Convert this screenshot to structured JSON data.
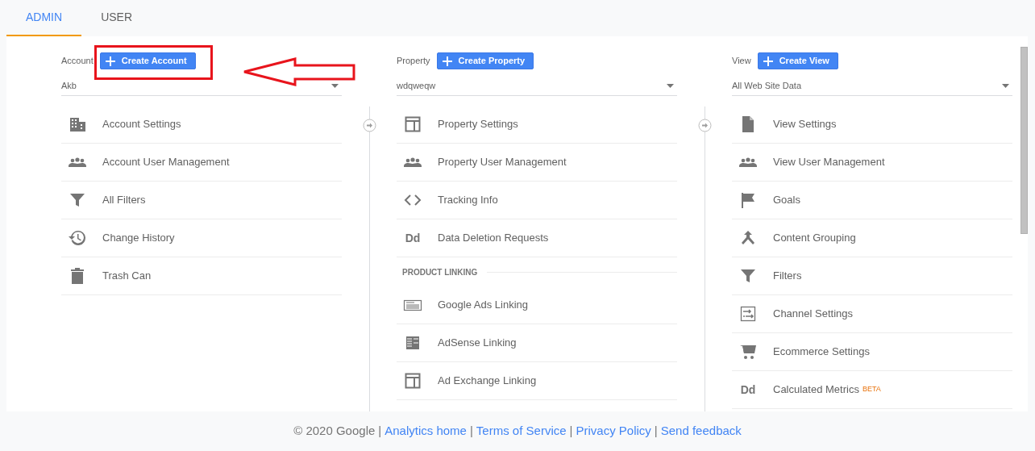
{
  "tabs": [
    {
      "label": "ADMIN",
      "selected": true
    },
    {
      "label": "USER",
      "selected": false
    }
  ],
  "columns": [
    {
      "label": "Account",
      "button": "Create Account",
      "dropdown": "Akb",
      "items": [
        {
          "kind": "link",
          "label": "Account Settings"
        },
        {
          "kind": "link",
          "label": "Account User Management"
        },
        {
          "kind": "link",
          "label": "All Filters"
        },
        {
          "kind": "link",
          "label": "Change History"
        },
        {
          "kind": "link",
          "label": "Trash Can"
        }
      ]
    },
    {
      "label": "Property",
      "button": "Create Property",
      "dropdown": "wdqweqw",
      "items": [
        {
          "kind": "link",
          "label": "Property Settings"
        },
        {
          "kind": "link",
          "label": "Property User Management"
        },
        {
          "kind": "link",
          "label": "Tracking Info"
        },
        {
          "kind": "link",
          "label": "Data Deletion Requests",
          "icon_text": "Dd"
        },
        {
          "kind": "section",
          "label": "PRODUCT LINKING"
        },
        {
          "kind": "link",
          "label": "Google Ads Linking"
        },
        {
          "kind": "link",
          "label": "AdSense Linking"
        },
        {
          "kind": "link",
          "label": "Ad Exchange Linking"
        }
      ]
    },
    {
      "label": "View",
      "button": "Create View",
      "dropdown": "All Web Site Data",
      "items": [
        {
          "kind": "link",
          "label": "View Settings"
        },
        {
          "kind": "link",
          "label": "View User Management"
        },
        {
          "kind": "link",
          "label": "Goals"
        },
        {
          "kind": "link",
          "label": "Content Grouping"
        },
        {
          "kind": "link",
          "label": "Filters"
        },
        {
          "kind": "link",
          "label": "Channel Settings"
        },
        {
          "kind": "link",
          "label": "Ecommerce Settings"
        },
        {
          "kind": "link",
          "label": "Calculated Metrics",
          "icon_text": "Dd",
          "badge": "BETA"
        }
      ]
    }
  ],
  "footer": [
    {
      "kind": "text",
      "text": "© 2020 Google"
    },
    {
      "kind": "separator",
      "text": "|"
    },
    {
      "kind": "link",
      "text": "Analytics home"
    },
    {
      "kind": "separator",
      "text": "|"
    },
    {
      "kind": "link",
      "text": "Terms of Service"
    },
    {
      "kind": "separator",
      "text": "|"
    },
    {
      "kind": "link",
      "text": "Privacy Policy"
    },
    {
      "kind": "separator",
      "text": "|"
    },
    {
      "kind": "link",
      "text": "Send feedback"
    }
  ]
}
